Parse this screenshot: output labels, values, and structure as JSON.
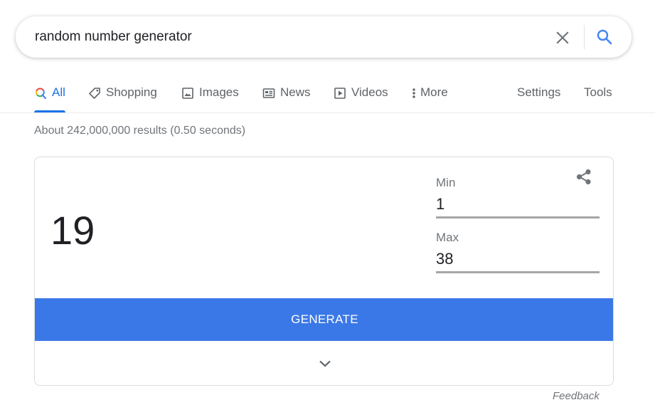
{
  "search": {
    "query": "random number generator"
  },
  "icons": {
    "clear": "close-icon",
    "search": "search-icon",
    "share": "share-icon",
    "expand": "chevron-down-icon"
  },
  "tabs": [
    {
      "label": "All",
      "icon": "search-icon",
      "active": true
    },
    {
      "label": "Shopping",
      "icon": "tag-icon"
    },
    {
      "label": "Images",
      "icon": "image-icon"
    },
    {
      "label": "News",
      "icon": "news-icon"
    },
    {
      "label": "Videos",
      "icon": "video-icon"
    },
    {
      "label": "More",
      "icon": "more-vert-icon"
    },
    {
      "label": "Settings"
    },
    {
      "label": "Tools"
    }
  ],
  "result_stats": "About 242,000,000 results (0.50 seconds)",
  "rng": {
    "result": "19",
    "min_label": "Min",
    "min_value": "1",
    "max_label": "Max",
    "max_value": "38",
    "generate_label": "GENERATE"
  },
  "feedback": "Feedback",
  "colors": {
    "accent_blue": "#1a73e8",
    "generate_blue": "#3b78e7",
    "muted_text": "#70757a"
  }
}
